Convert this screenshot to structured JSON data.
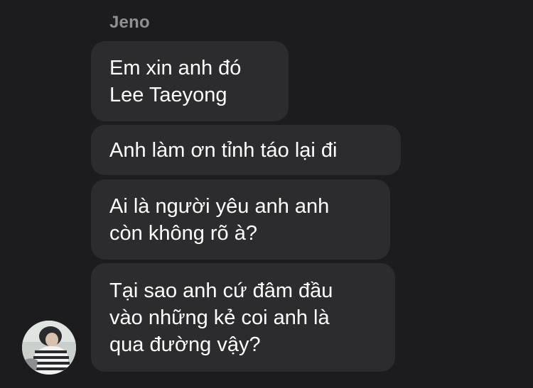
{
  "conversation": {
    "sender_name": "Jeno",
    "messages": [
      {
        "text": "Em xin anh đó\nLee Taeyong"
      },
      {
        "text": "Anh làm ơn tỉnh táo lại đi"
      },
      {
        "text": "Ai là người yêu anh anh\ncòn không rõ à?"
      },
      {
        "text": "Tại sao anh cứ đâm đầu\nvào những kẻ coi anh là\nqua đường vậy?"
      }
    ]
  },
  "colors": {
    "background": "#1c1c1e",
    "bubble": "#2c2c2e",
    "sender_name": "#8e8e93",
    "message_text": "#ffffff"
  },
  "icons": {
    "avatar": "profile-photo"
  }
}
